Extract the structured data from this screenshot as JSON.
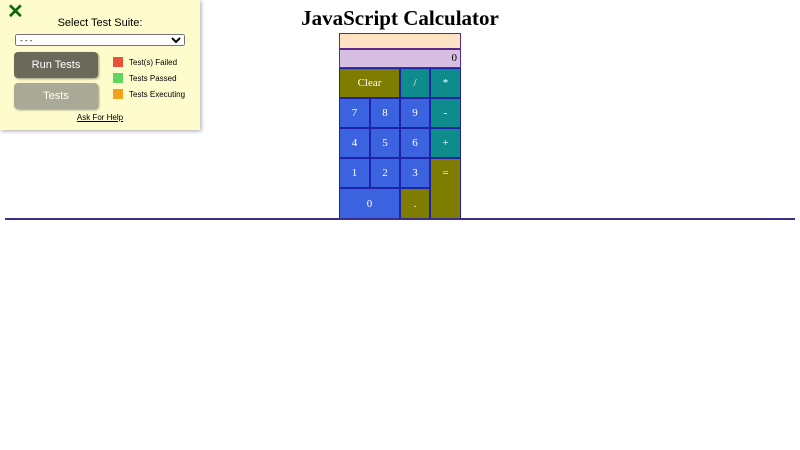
{
  "page": {
    "title": "JavaScript Calculator"
  },
  "calculator": {
    "formula": "",
    "output": "0",
    "keys": {
      "clear": "Clear",
      "divide": "/",
      "multiply": "*",
      "seven": "7",
      "eight": "8",
      "nine": "9",
      "subtract": "-",
      "four": "4",
      "five": "5",
      "six": "6",
      "add": "+",
      "one": "1",
      "two": "2",
      "three": "3",
      "equals": "=",
      "zero": "0",
      "decimal": "."
    },
    "colors": {
      "olive": "#7e7d00",
      "teal": "#0e8c8c",
      "blue": "#3b63e0",
      "formula_bg": "#fde3c3",
      "output_bg": "#d6bfe0"
    }
  },
  "test_panel": {
    "close_icon": "close-x-icon",
    "suite_label": "Select Test Suite:",
    "suite_selected": "- - -",
    "run_button": "Run Tests",
    "tests_button": "Tests",
    "legend": [
      {
        "label": "Test(s) Failed",
        "color": "#e8513a"
      },
      {
        "label": "Tests Passed",
        "color": "#5fd45f"
      },
      {
        "label": "Tests Executing",
        "color": "#f2a21b"
      }
    ],
    "help_link": "Ask For Help"
  }
}
